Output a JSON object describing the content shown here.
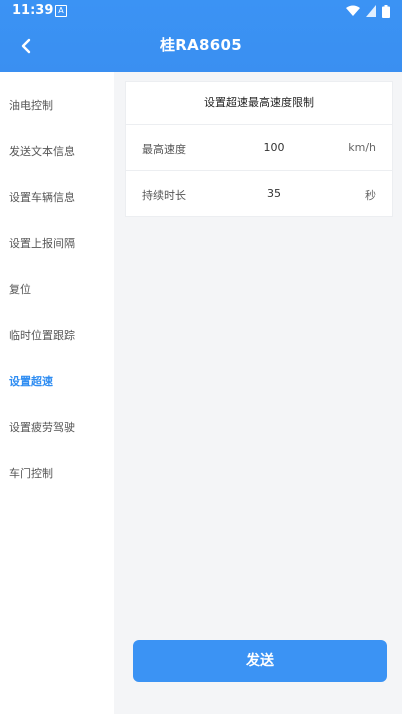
{
  "status": {
    "time": "11:39",
    "a_icon": "A"
  },
  "header": {
    "title": "桂RA8605"
  },
  "sidebar": {
    "items": [
      {
        "label": "油电控制"
      },
      {
        "label": "发送文本信息"
      },
      {
        "label": "设置车辆信息"
      },
      {
        "label": "设置上报间隔"
      },
      {
        "label": "复位"
      },
      {
        "label": "临时位置跟踪"
      },
      {
        "label": "设置超速"
      },
      {
        "label": "设置疲劳驾驶"
      },
      {
        "label": "车门控制"
      }
    ]
  },
  "card": {
    "title": "设置超速最高速度限制",
    "rows": [
      {
        "label": "最高速度",
        "value": "100",
        "unit": "km/h"
      },
      {
        "label": "持续时长",
        "value": "35",
        "unit": "秒"
      }
    ]
  },
  "actions": {
    "send_label": "发送"
  },
  "colors": {
    "accent": "#3b93f4",
    "active_text": "#2f8df2"
  }
}
